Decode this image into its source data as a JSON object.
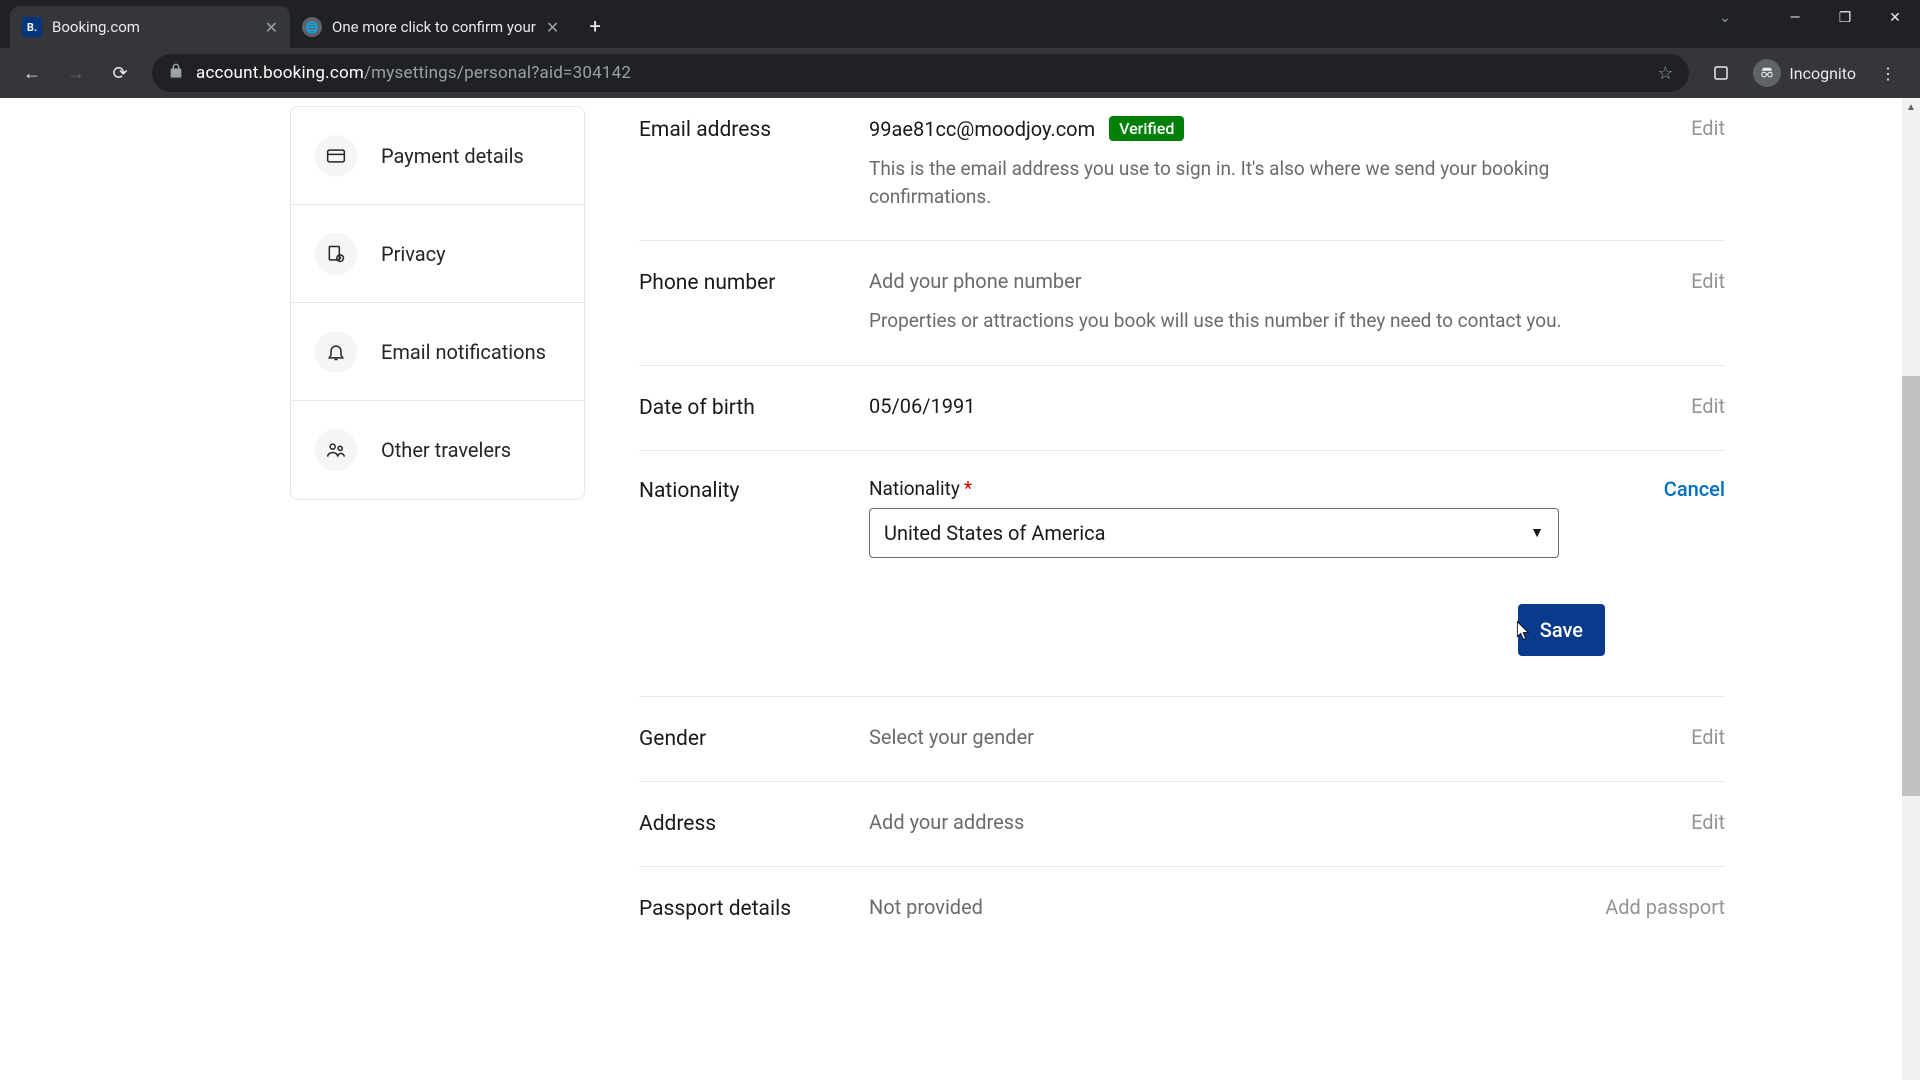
{
  "browser": {
    "tabs": [
      {
        "title": "Booking.com",
        "favicon_bg": "#003580",
        "favicon_text": "B."
      },
      {
        "title": "One more click to confirm your",
        "favicon_bg": "#5f6368",
        "favicon_text": ""
      }
    ],
    "url_host": "account.booking.com",
    "url_path": "/mysettings/personal?aid=304142",
    "incognito_label": "Incognito"
  },
  "sidebar": {
    "items": [
      {
        "label": "Payment details",
        "icon": "payment"
      },
      {
        "label": "Privacy",
        "icon": "privacy"
      },
      {
        "label": "Email notifications",
        "icon": "bell"
      },
      {
        "label": "Other travelers",
        "icon": "people"
      }
    ]
  },
  "settings": {
    "email": {
      "label": "Email address",
      "value": "99ae81cc@moodjoy.com",
      "badge": "Verified",
      "helper": "This is the email address you use to sign in. It's also where we send your booking confirmations.",
      "action": "Edit"
    },
    "phone": {
      "label": "Phone number",
      "placeholder": "Add your phone number",
      "helper": "Properties or attractions you book will use this number if they need to contact you.",
      "action": "Edit"
    },
    "dob": {
      "label": "Date of birth",
      "value": "05/06/1991",
      "action": "Edit"
    },
    "nationality": {
      "label": "Nationality",
      "field_label": "Nationality",
      "required_mark": "*",
      "selected": "United States of America",
      "cancel": "Cancel",
      "save": "Save"
    },
    "gender": {
      "label": "Gender",
      "placeholder": "Select your gender",
      "action": "Edit"
    },
    "address": {
      "label": "Address",
      "placeholder": "Add your address",
      "action": "Edit"
    },
    "passport": {
      "label": "Passport details",
      "placeholder": "Not provided",
      "action": "Add passport"
    }
  }
}
